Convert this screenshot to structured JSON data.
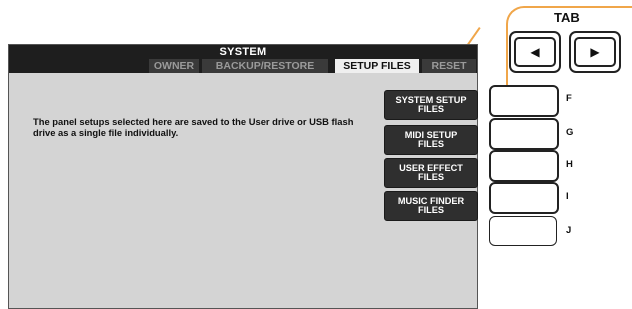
{
  "window": {
    "title": "SYSTEM",
    "tabs": [
      "OWNER",
      "BACKUP/RESTORE",
      "SETUP FILES",
      "RESET"
    ],
    "active_tab": "SETUP FILES"
  },
  "main": {
    "description": "The panel setups selected here are saved to the User drive or USB flash drive as a single file individually."
  },
  "buttons": [
    {
      "label": "SYSTEM SETUP\nFILES",
      "key": "F"
    },
    {
      "label": "MIDI SETUP\nFILES",
      "key": "G"
    },
    {
      "label": "USER EFFECT\nFILES",
      "key": "H"
    },
    {
      "label": "MUSIC FINDER\nFILES",
      "key": "I"
    },
    {
      "label": "",
      "key": "J"
    }
  ],
  "tab_control": {
    "label": "TAB",
    "left_arrow": "◀",
    "right_arrow": "▶"
  },
  "colors": {
    "highlight": "#f0a64a",
    "screen_bg": "#d4d4d4",
    "titlebar_bg": "#1e1e1e",
    "button_bg": "#2f2f2f"
  },
  "icons": {
    "left": "left-arrow-icon",
    "right": "right-arrow-icon"
  }
}
